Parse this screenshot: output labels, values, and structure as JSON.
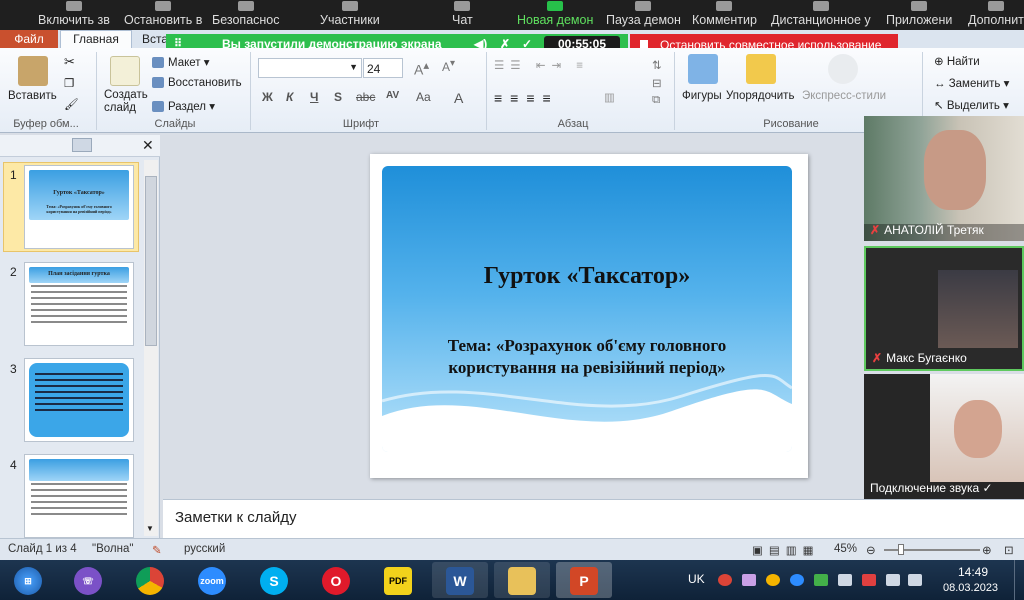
{
  "zoom_toolbar": {
    "items": [
      "Включить зв",
      "Остановить в",
      "Безопаснос",
      "Участники",
      "Чат",
      "Новая демон",
      "Пауза демон",
      "Комментир",
      "Дистанционное у",
      "Приложени",
      "Дополнит"
    ]
  },
  "share_banner": {
    "message": "Вы запустили демонстрацию экрана",
    "timer": "00:55:05",
    "stop_label": "Остановить совместное использование"
  },
  "ribbon": {
    "tabs": [
      "Файл",
      "Главная",
      "Вста"
    ],
    "paste": "Вставить",
    "create_slide": "Создать слайд",
    "layout": "Макет",
    "reset": "Восстановить",
    "section": "Раздел",
    "font_size": "24",
    "shapes": "Фигуры",
    "arrange": "Упорядочить",
    "quick_styles": "Экспресс-стили",
    "find": "Найти",
    "replace": "Заменить",
    "select": "Выделить",
    "font_buttons": [
      "Ж",
      "К",
      "Ч",
      "S",
      "abc",
      "AV",
      "Aa",
      "A"
    ],
    "groups": [
      "Буфер обм...",
      "Слайды",
      "Шрифт",
      "Абзац",
      "Рисование"
    ]
  },
  "slides": [
    {
      "num": "1",
      "title": "Гурток «Таксатор»",
      "sub": "Тема: «Розрахунок об'єму головного користування на ревізійний період»"
    },
    {
      "num": "2",
      "title": "План засідання гуртка"
    },
    {
      "num": "3"
    },
    {
      "num": "4"
    }
  ],
  "current_slide": {
    "title": "Гурток «Таксатор»",
    "subtitle": "Тема: «Розрахунок об'єму головного користування на ревізійний період»"
  },
  "notes_placeholder": "Заметки к слайду",
  "participants": [
    {
      "name": "АНАТОЛІЙ Третяк",
      "muted": true
    },
    {
      "name": "Макс Бугаєнко",
      "muted": true
    },
    {
      "name": "Подключение звука ✓",
      "muted": false
    }
  ],
  "status_bar": {
    "slide_info": "Слайд 1 из 4",
    "theme": "\"Волна\"",
    "language": "русский",
    "zoom": "45%"
  },
  "taskbar": {
    "lang": "UK",
    "time": "14:49",
    "date": "08.03.2023",
    "apps": [
      "zoom",
      "PDF",
      "W"
    ]
  }
}
